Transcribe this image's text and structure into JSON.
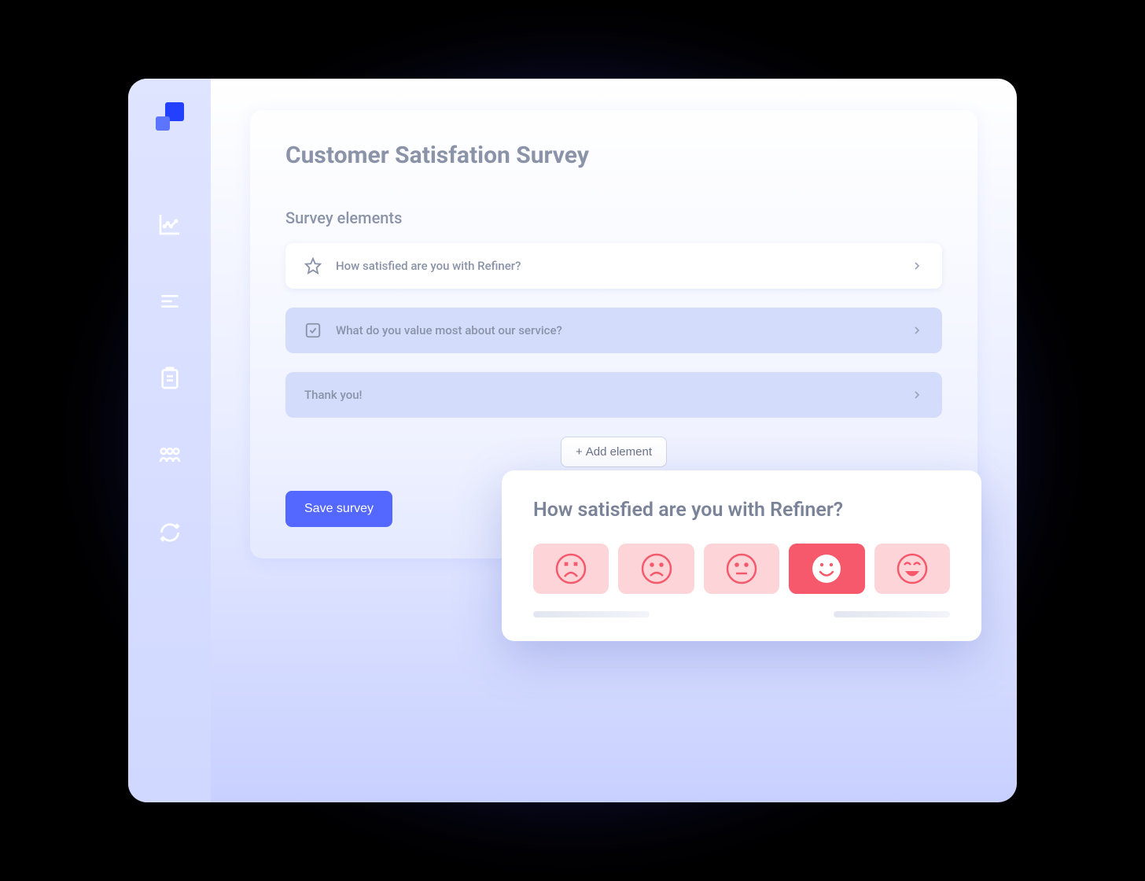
{
  "page": {
    "title": "Customer Satisfation Survey",
    "section_title": "Survey elements"
  },
  "elements": [
    {
      "label": "How satisfied are you with Refiner?",
      "type": "rating"
    },
    {
      "label": "What do you value most about our service?",
      "type": "choice"
    },
    {
      "label": "Thank you!",
      "type": "message"
    }
  ],
  "buttons": {
    "add_element": "Add element",
    "save_survey": "Save survey"
  },
  "preview": {
    "question": "How satisfied are you with Refiner?",
    "options": [
      "very-unhappy",
      "unhappy",
      "neutral",
      "happy",
      "very-happy"
    ],
    "selected_index": 3
  },
  "colors": {
    "primary": "#5468ff",
    "rating_bg": "#fdd4d8",
    "rating_selected": "#f5596b"
  }
}
